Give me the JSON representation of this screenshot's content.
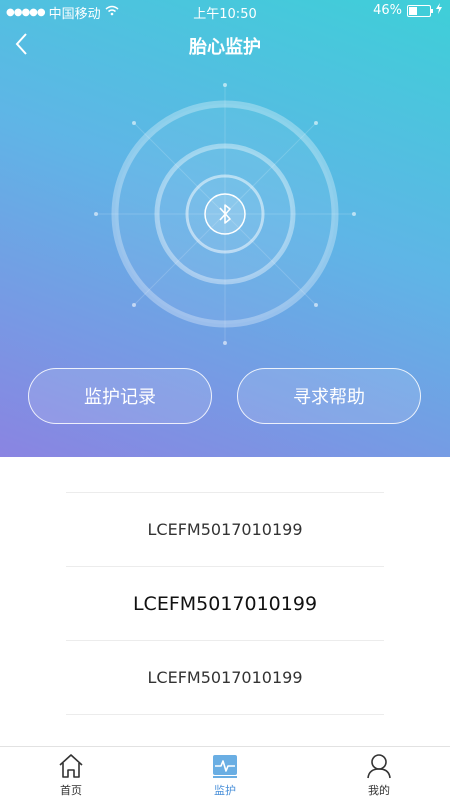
{
  "status_bar": {
    "signal": "●●●●●",
    "carrier": "中国移动",
    "time": "上午10:50",
    "battery": "46%",
    "battery_level": 0.46
  },
  "header": {
    "title": "胎心监护"
  },
  "colors": {
    "gradient_top": "#3ecfd8",
    "gradient_bottom": "#8a84e2",
    "active_tab": "#4a90d9"
  },
  "actions": {
    "records_label": "监护记录",
    "help_label": "寻求帮助"
  },
  "devices": [
    "LCEFM5017010199",
    "LCEFM5017010199",
    "LCEFM5017010199"
  ],
  "tabbar": {
    "home": "首页",
    "monitor": "监护",
    "mine": "我的"
  }
}
